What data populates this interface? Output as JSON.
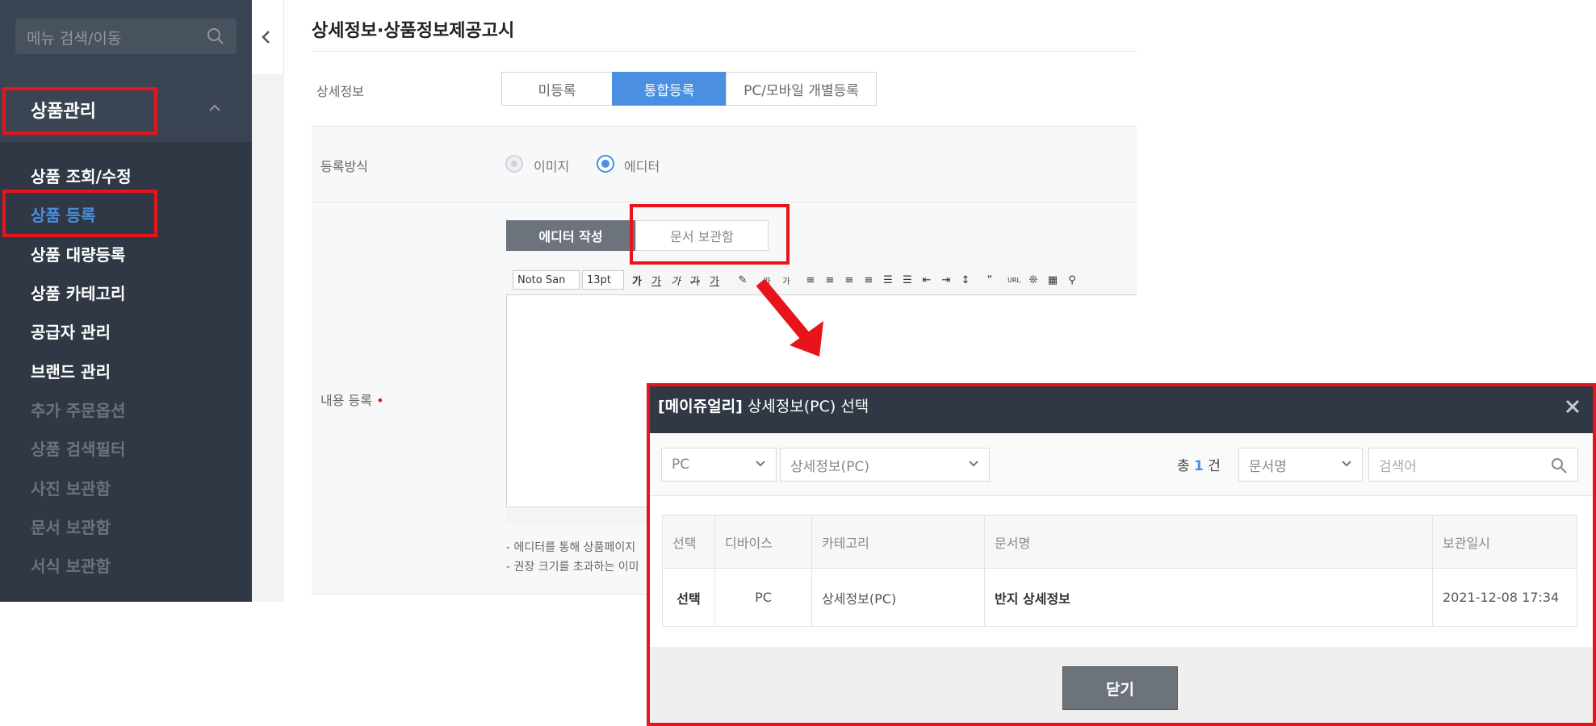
{
  "sidebar": {
    "search_placeholder": "메뉴 검색/이동",
    "category_title": "상품관리",
    "items": [
      {
        "label": "상품 조회/수정"
      },
      {
        "label": "상품 등록"
      },
      {
        "label": "상품 대량등록"
      },
      {
        "label": "상품 카테고리"
      },
      {
        "label": "공급자 관리"
      },
      {
        "label": "브랜드 관리"
      },
      {
        "label": "추가 주문옵션"
      },
      {
        "label": "상품 검색필터"
      },
      {
        "label": "사진 보관함"
      },
      {
        "label": "문서 보관함"
      },
      {
        "label": "서식 보관함"
      }
    ],
    "active_item": "상품 등록"
  },
  "main": {
    "page_title": "상세정보·상품정보제공고시",
    "detail_label": "상세정보",
    "detail_options": [
      "미등록",
      "통합등록",
      "PC/모바일 개별등록"
    ],
    "detail_selected": "통합등록",
    "method_label": "등록방식",
    "method_options": [
      "이미지",
      "에디터"
    ],
    "method_selected": "에디터",
    "content_label": "내용 등록",
    "required_mark": "•",
    "editor_tabs": [
      "에디터 작성",
      "문서 보관함"
    ],
    "toolbar": {
      "font": "Noto San",
      "size": "13pt",
      "buttons": [
        "가",
        "가",
        "가",
        "가",
        "가",
        "가",
        "가",
        "가"
      ]
    },
    "notes": [
      "- 에디터를 통해 상품페이지",
      "- 권장 크기를 초과하는 이미"
    ]
  },
  "dialog": {
    "title_bold": "[메이쥬얼리]",
    "title_rest": " 상세정보(PC) 선택",
    "device_select": "PC",
    "category_select": "상세정보(PC)",
    "total_prefix": "총 ",
    "total_count": "1",
    "total_suffix": " 건",
    "search_type": "문서명",
    "search_placeholder": "검색어",
    "columns": [
      "선택",
      "디바이스",
      "카테고리",
      "문서명",
      "보관일시"
    ],
    "rows": [
      {
        "select": "선택",
        "device": "PC",
        "category": "상세정보(PC)",
        "name": "반지 상세정보",
        "date": "2021-12-08 17:34"
      }
    ],
    "close_label": "닫기"
  },
  "colors": {
    "accent": "#4a8fe2",
    "highlight": "#e8141c",
    "sidebar": "#2f3844"
  }
}
